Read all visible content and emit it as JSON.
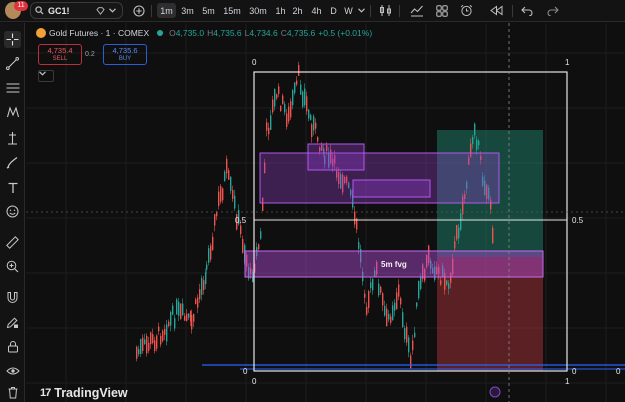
{
  "symbol_search": {
    "value": "GC1!",
    "avatar_badge": "11"
  },
  "timeframes": [
    "1m",
    "3m",
    "5m",
    "15m",
    "30m",
    "1h",
    "2h",
    "4h",
    "D",
    "W"
  ],
  "active_timeframe": "1m",
  "legend": {
    "name": "Gold Futures · 1 · COMEX",
    "o_label": "O",
    "o": "4,735.0",
    "h_label": "H",
    "h": "4,735.6",
    "l_label": "L",
    "l": "4,734.6",
    "c_label": "C",
    "c": "4,735.6",
    "change": "+0.5 (+0.01%)"
  },
  "trade": {
    "sell_price": "4,735.4",
    "sell_label": "SELL",
    "spread": "0.2",
    "buy_price": "4,735.6",
    "buy_label": "BUY"
  },
  "fib": {
    "top_left": "0",
    "top_right": "1",
    "mid_left": "0.5",
    "mid_right": "0.5",
    "bottom_left": "0",
    "bottom_right": "0",
    "axis_left": "0",
    "axis_right": "1"
  },
  "zone_label": "5m fvg",
  "watermark": "TradingView",
  "colors": {
    "up": "#26a69a",
    "down": "#ef5350",
    "fvg_purple": "#9b3fd4",
    "fib_white": "#e6e6e6",
    "level_blue": "#2962ff",
    "long_green": "#1e8f78",
    "stop_red": "#a8323a"
  }
}
